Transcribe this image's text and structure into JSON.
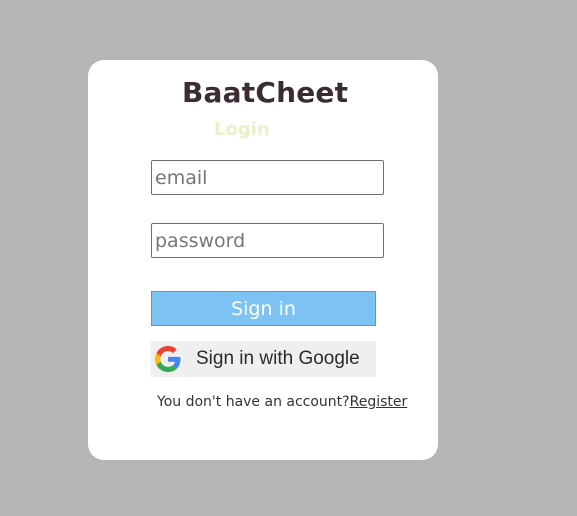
{
  "app": {
    "title": "BaatCheet",
    "subtitle": "Login"
  },
  "form": {
    "email": {
      "value": "",
      "placeholder": "email"
    },
    "password": {
      "value": "",
      "placeholder": "password"
    },
    "signin_label": "Sign in",
    "google_label": "Sign in with Google"
  },
  "footer": {
    "prompt": "You don't have an account?",
    "register_label": "Register"
  },
  "colors": {
    "background": "#b5b5b4",
    "card": "#ffffff",
    "title": "#3a2b35",
    "subtitle": "#e6f2c8",
    "signin_button": "#7cc2f2",
    "google_button": "#efefef"
  },
  "icons": {
    "google": "google-g-logo"
  }
}
